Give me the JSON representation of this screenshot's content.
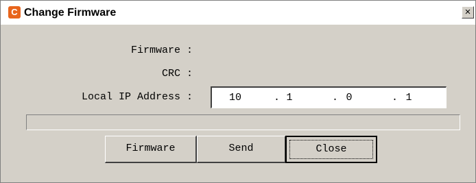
{
  "window": {
    "title": "Change Firmware",
    "app_icon_glyph": "C",
    "close_glyph": "×"
  },
  "form": {
    "firmware_label": "Firmware :",
    "firmware_value": "",
    "crc_label": "CRC :",
    "crc_value": "",
    "ip_label": "Local IP Address :",
    "ip_parts": [
      "10",
      "1",
      "0",
      "1"
    ],
    "ip_separator": "."
  },
  "progress": {
    "value": 0
  },
  "buttons": {
    "firmware_label": "Firmware",
    "send_label": "Send",
    "close_label": "Close"
  },
  "colors": {
    "dialog_bg": "#d4d0c8",
    "app_icon": "#e8651c"
  }
}
